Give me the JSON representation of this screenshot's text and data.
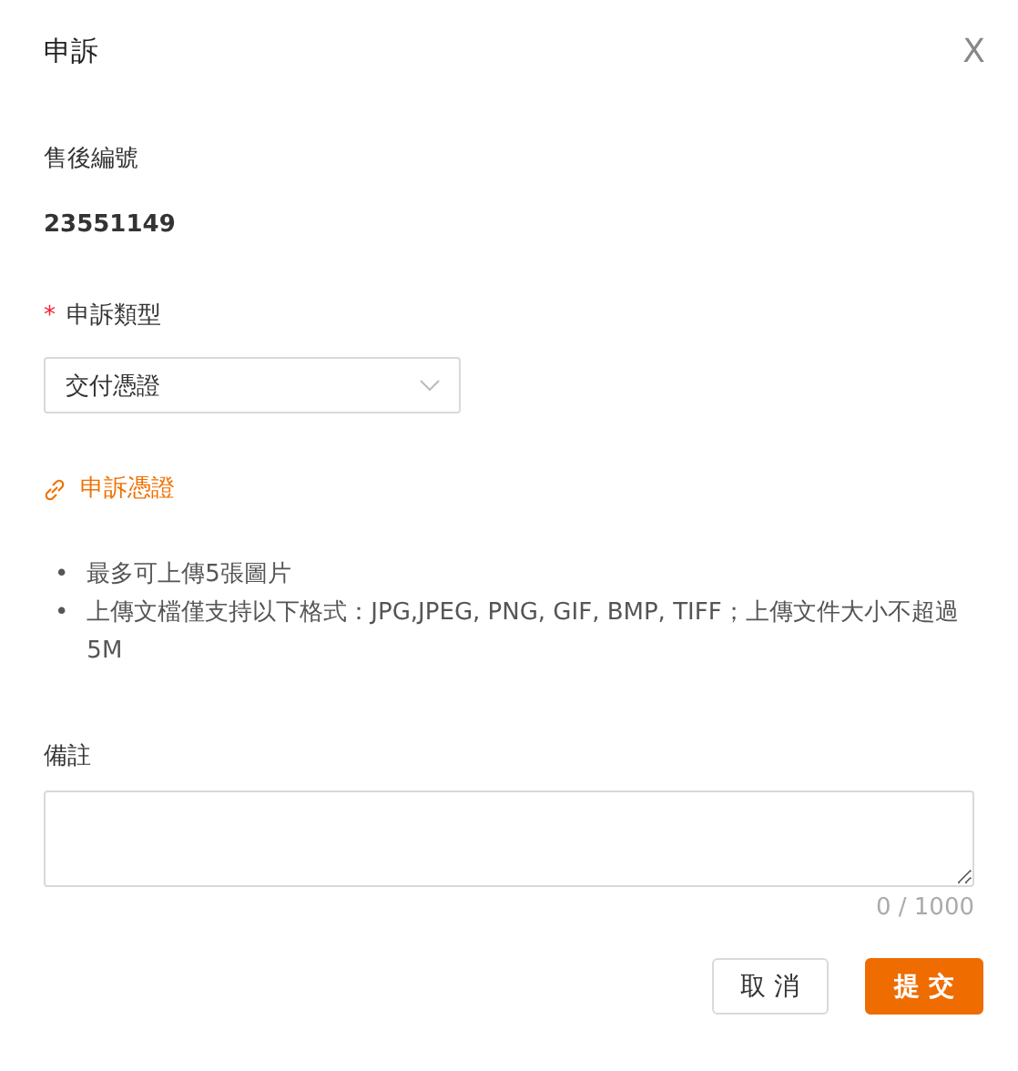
{
  "dialog": {
    "title": "申訴",
    "close": "X"
  },
  "fields": [
    {
      "kind": "static",
      "label": "售後編號",
      "required": false,
      "value": "23551149"
    },
    {
      "kind": "select",
      "label": "申訴類型",
      "required": true,
      "required_mark": "*",
      "value": "交付憑證"
    }
  ],
  "upload_link": {
    "label": "申訴憑證"
  },
  "notes": [
    {
      "bullet": "•",
      "text": "最多可上傳5張圖片"
    },
    {
      "bullet": "•",
      "text": "上傳文檔僅支持以下格式：JPG,JPEG, PNG, GIF, BMP, TIFF；上傳文件大小不超過5M"
    }
  ],
  "remark": {
    "label": "備註",
    "counter": "0 / 1000"
  },
  "buttons": [
    {
      "kind": "default",
      "label": "取 消"
    },
    {
      "kind": "primary",
      "label": "提 交"
    }
  ]
}
